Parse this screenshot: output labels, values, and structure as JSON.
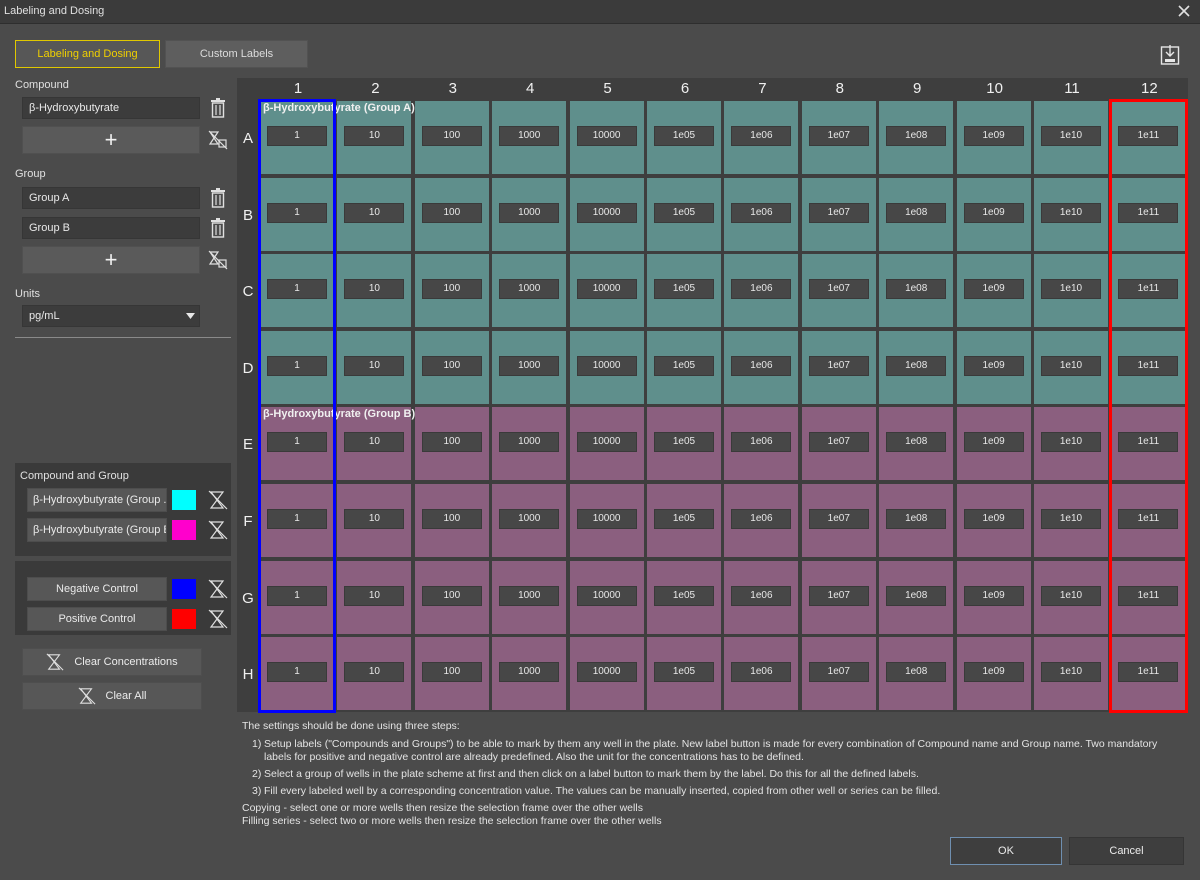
{
  "window": {
    "title": "Labeling and Dosing"
  },
  "tabs": [
    {
      "label": "Labeling and Dosing",
      "active": true
    },
    {
      "label": "Custom Labels",
      "active": false
    }
  ],
  "compound": {
    "label": "Compound",
    "items": [
      "β-Hydroxybutyrate"
    ]
  },
  "group": {
    "label": "Group",
    "items": [
      "Group A",
      "Group B"
    ]
  },
  "units": {
    "label": "Units",
    "value": "pg/mL"
  },
  "compound_and_group": {
    "label": "Compound and Group",
    "items": [
      {
        "label": "β-Hydroxybutyrate  (Group ...",
        "color": "#00ffff"
      },
      {
        "label": "β-Hydroxybutyrate  (Group B)",
        "color": "#ff00cc"
      }
    ]
  },
  "controls": [
    {
      "label": "Negative Control",
      "color": "#0000ff"
    },
    {
      "label": "Positive Control",
      "color": "#ff0000"
    }
  ],
  "actions": {
    "clear_concentrations": "Clear Concentrations",
    "clear_all": "Clear All"
  },
  "plate": {
    "columns": [
      "1",
      "2",
      "3",
      "4",
      "5",
      "6",
      "7",
      "8",
      "9",
      "10",
      "11",
      "12"
    ],
    "rows": [
      "A",
      "B",
      "C",
      "D",
      "E",
      "F",
      "G",
      "H"
    ],
    "concentrations": [
      "1",
      "10",
      "100",
      "1000",
      "10000",
      "1e05",
      "1e06",
      "1e07",
      "1e08",
      "1e09",
      "1e10",
      "1e11"
    ],
    "group_a_label": "β-Hydroxybutyrate  (Group A)",
    "group_b_label": "β-Hydroxybutyrate  (Group B)",
    "group_a_color": "#5f8f8c",
    "group_b_color": "#8b5f7f",
    "negative_control_column": "1",
    "positive_control_column": "12"
  },
  "instructions": {
    "intro": "The settings should be done using three steps:",
    "steps": [
      {
        "num": "1)",
        "text": "Setup labels (\"Compounds and Groups\") to be able to mark by them any well in the plate. New label button is made for every combination of Compound name and Group name. Two mandatory labels for positive and negative control are already predefined. Also the unit for the concentrations has to be defined."
      },
      {
        "num": "2)",
        "text": "Select a group of wells in the plate scheme at first and then click on a label button to mark them by the label. Do this for all the defined labels."
      },
      {
        "num": "3)",
        "text": "Fill every labeled well by a corresponding concentration value. The values can be manually inserted, copied from other well or series can be filled."
      }
    ],
    "copying": "Copying - select one or more wells then resize the selection frame over the other wells",
    "filling": "Filling series - select two or more wells then resize the selection frame over the other wells"
  },
  "footer": {
    "ok": "OK",
    "cancel": "Cancel"
  }
}
